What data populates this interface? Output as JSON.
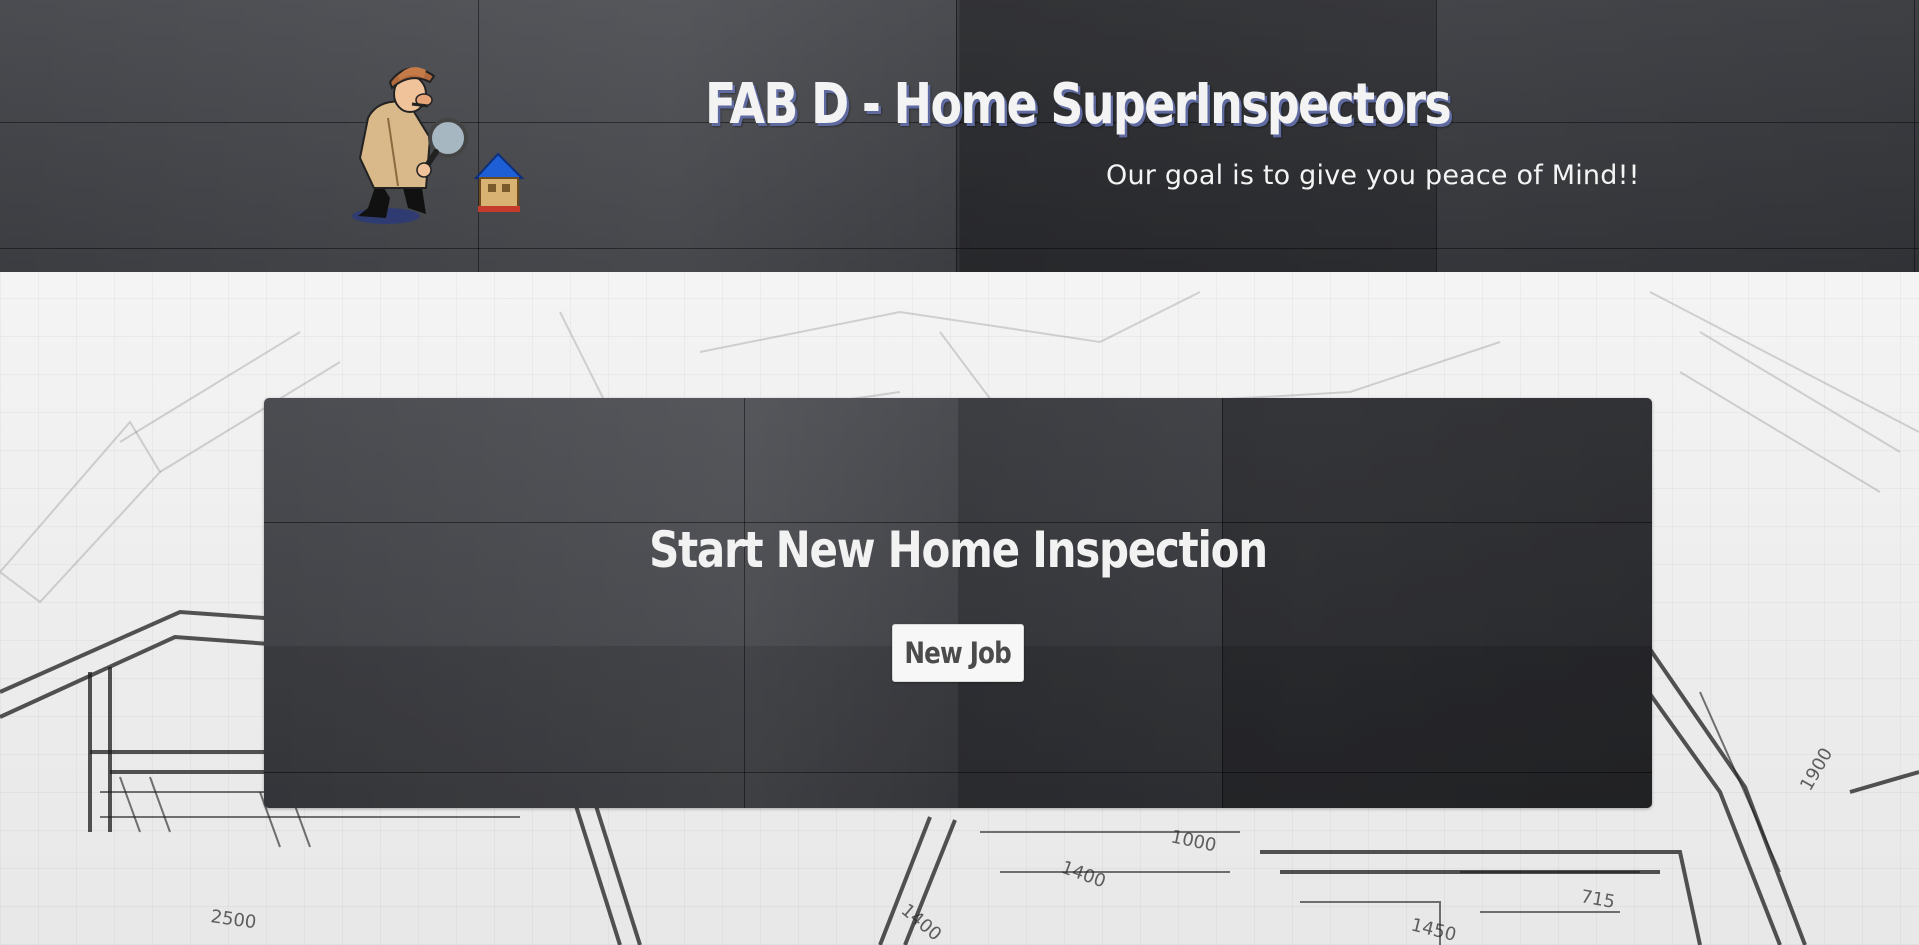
{
  "header": {
    "title": "FAB D - Home SuperInspectors",
    "tagline": "Our goal is to give you peace of Mind!!",
    "logo_icon": "detective-with-magnifier-and-house-icon"
  },
  "main": {
    "card_title": "Start New Home Inspection",
    "new_job_label": "New Job"
  },
  "background": {
    "blueprint_labels": [
      "2500",
      "1000",
      "1400",
      "1450",
      "715",
      "1400",
      "1900"
    ]
  },
  "colors": {
    "panel": "#3d3f44",
    "title_shadow": "#5f6aa0",
    "button_bg": "#f7f7f7",
    "button_text": "#4b4b4b"
  }
}
